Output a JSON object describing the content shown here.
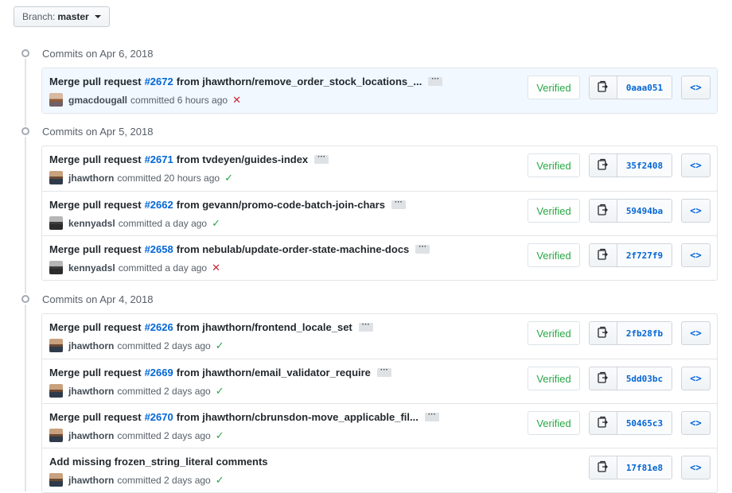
{
  "branch": {
    "label": "Branch:",
    "value": "master"
  },
  "groups": [
    {
      "title": "Commits on Apr 6, 2018",
      "commits": [
        {
          "prefix": "Merge pull request",
          "pr": "#2672",
          "rest": "from jhawthorn/remove_order_stock_locations_...",
          "author": "gmacdougall",
          "when": "committed 6 hours ago",
          "status": "fail",
          "verified": "Verified",
          "sha": "0aaa051"
        }
      ]
    },
    {
      "title": "Commits on Apr 5, 2018",
      "commits": [
        {
          "prefix": "Merge pull request",
          "pr": "#2671",
          "rest": "from tvdeyen/guides-index",
          "author": "jhawthorn",
          "when": "committed 20 hours ago",
          "status": "ok",
          "verified": "Verified",
          "sha": "35f2408"
        },
        {
          "prefix": "Merge pull request",
          "pr": "#2662",
          "rest": "from gevann/promo-code-batch-join-chars",
          "author": "kennyadsl",
          "when": "committed a day ago",
          "status": "ok",
          "verified": "Verified",
          "sha": "59494ba"
        },
        {
          "prefix": "Merge pull request",
          "pr": "#2658",
          "rest": "from nebulab/update-order-state-machine-docs",
          "author": "kennyadsl",
          "when": "committed a day ago",
          "status": "fail",
          "verified": "Verified",
          "sha": "2f727f9"
        }
      ]
    },
    {
      "title": "Commits on Apr 4, 2018",
      "commits": [
        {
          "prefix": "Merge pull request",
          "pr": "#2626",
          "rest": "from jhawthorn/frontend_locale_set",
          "author": "jhawthorn",
          "when": "committed 2 days ago",
          "status": "ok",
          "verified": "Verified",
          "sha": "2fb28fb"
        },
        {
          "prefix": "Merge pull request",
          "pr": "#2669",
          "rest": "from jhawthorn/email_validator_require",
          "author": "jhawthorn",
          "when": "committed 2 days ago",
          "status": "ok",
          "verified": "Verified",
          "sha": "5dd03bc"
        },
        {
          "prefix": "Merge pull request",
          "pr": "#2670",
          "rest": "from jhawthorn/cbrunsdon-move_applicable_fil...",
          "author": "jhawthorn",
          "when": "committed 2 days ago",
          "status": "ok",
          "verified": "Verified",
          "sha": "50465c3"
        },
        {
          "prefix": "Add missing frozen_string_literal comments",
          "pr": "",
          "rest": "",
          "author": "jhawthorn",
          "when": "committed 2 days ago",
          "status": "ok",
          "verified": "",
          "sha": "17f81e8"
        }
      ]
    }
  ],
  "icons": {
    "ellipsis": "···",
    "ok": "✓",
    "fail": "✕",
    "browse": "<>"
  },
  "colors": {
    "link": "#0366d6",
    "ok": "#28a745",
    "fail": "#cb2431",
    "highlight": "#f1f8ff"
  }
}
